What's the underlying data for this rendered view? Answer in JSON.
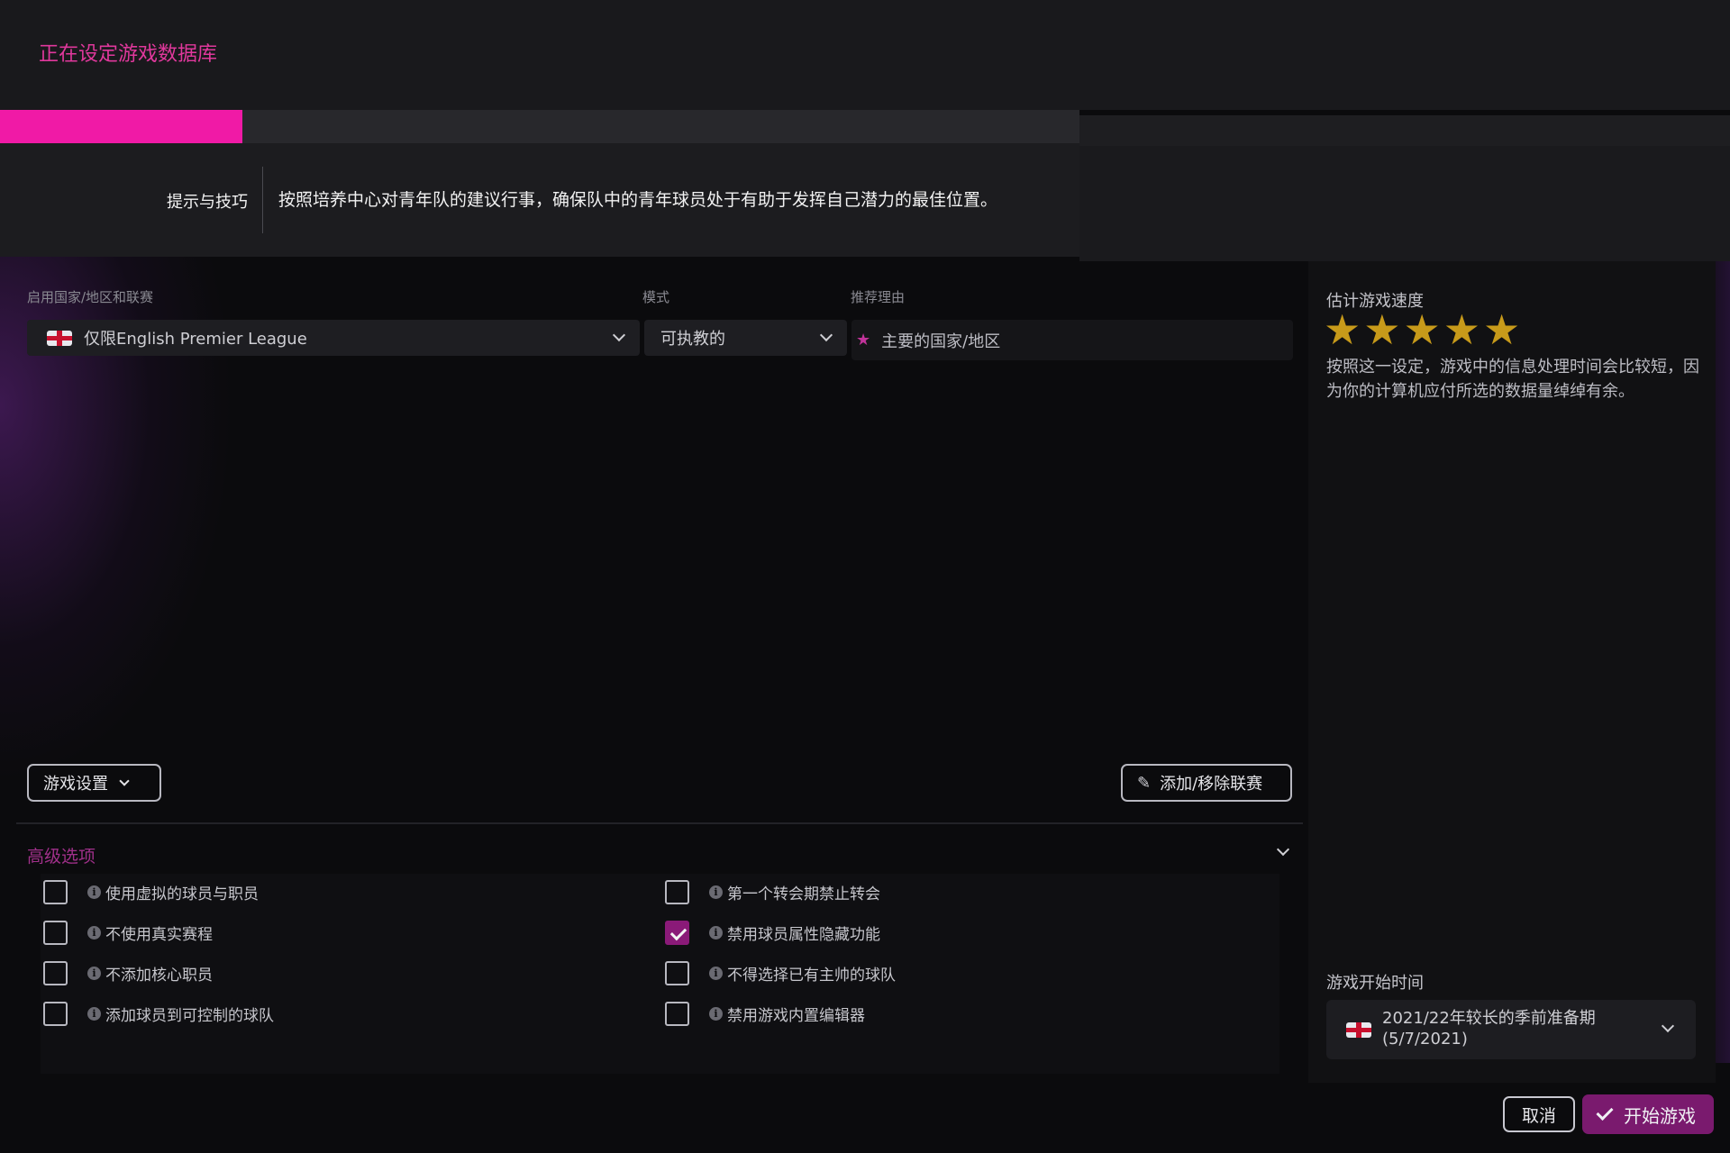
{
  "header": {
    "title": "正在设定游戏数据库"
  },
  "progress": {
    "fraction": 0.14
  },
  "tips": {
    "label": "提示与技巧",
    "text": "按照培养中心对青年队的建议行事，确保队中的青年球员处于有助于发挥自己潜力的最佳位置。"
  },
  "columns": {
    "league": "启用国家/地区和联赛",
    "mode": "模式",
    "reason": "推荐理由"
  },
  "league_select": {
    "value": "仅限English Premier League"
  },
  "mode_select": {
    "value": "可执教的"
  },
  "reason": {
    "value": "主要的国家/地区"
  },
  "buttons": {
    "game_settings": "游戏设置",
    "add_remove_league": "添加/移除联赛",
    "cancel": "取消",
    "start_game": "开始游戏"
  },
  "advanced": {
    "label": "高级选项",
    "options": [
      {
        "label": "使用虚拟的球员与职员",
        "checked": false
      },
      {
        "label": "不使用真实赛程",
        "checked": false
      },
      {
        "label": "不添加核心职员",
        "checked": false
      },
      {
        "label": "添加球员到可控制的球队",
        "checked": false
      },
      {
        "label": "第一个转会期禁止转会",
        "checked": false
      },
      {
        "label": "禁用球员属性隐藏功能",
        "checked": true
      },
      {
        "label": "不得选择已有主帅的球队",
        "checked": false
      },
      {
        "label": "禁用游戏内置编辑器",
        "checked": false
      }
    ]
  },
  "speed": {
    "label": "估计游戏速度",
    "rating": 5,
    "max_rating": 5,
    "text": "按照这一设定，游戏中的信息处理时间会比较短，因为你的计算机应付所选的数据量绰绰有余。"
  },
  "start_time": {
    "label": "游戏开始时间",
    "line1": "2021/22年较长的季前准备期",
    "line2": "(5/7/2021)"
  },
  "colors": {
    "accent": "#f01aa6",
    "title": "#e0389c",
    "star": "#c79a1a",
    "checkbox_checked": "#8a1a78"
  }
}
